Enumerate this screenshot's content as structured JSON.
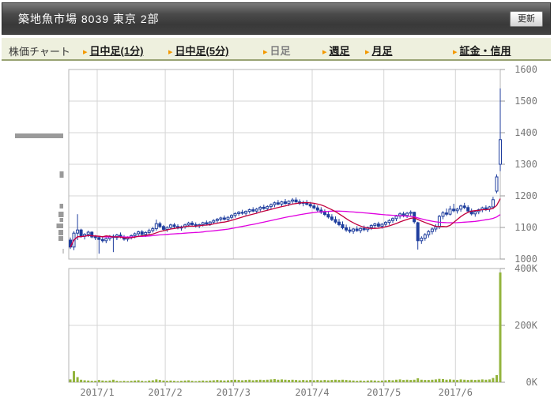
{
  "header": {
    "title": "築地魚市場  8039  東京 2部",
    "refresh_label": "更新"
  },
  "toolbar": {
    "label": "株価チャート",
    "tabs": [
      {
        "label": "日中足(1分)",
        "active": false
      },
      {
        "label": "日中足(5分)",
        "active": false
      },
      {
        "label": "日足",
        "active": true
      },
      {
        "label": "週足",
        "active": false
      },
      {
        "label": "月足",
        "active": false
      },
      {
        "label": "証金・信用",
        "active": false
      }
    ]
  },
  "chart_data": {
    "type": "candlestick+volume",
    "price_axis": {
      "min": 1000,
      "max": 1600,
      "ticks": [
        1000,
        1100,
        1200,
        1300,
        1400,
        1500,
        1600
      ]
    },
    "volume_axis": {
      "min": 0,
      "max": 400000,
      "tick_labels": [
        "0K",
        "200K",
        "400K"
      ]
    },
    "x_labels": [
      "2017/1",
      "2017/2",
      "2017/3",
      "2017/4",
      "2017/5",
      "2017/6"
    ],
    "month_ticks": [
      {
        "label": "2017/1",
        "index": 8
      },
      {
        "label": "2017/2",
        "index": 27
      },
      {
        "label": "2017/3",
        "index": 46
      },
      {
        "label": "2017/4",
        "index": 68
      },
      {
        "label": "2017/5",
        "index": 88
      },
      {
        "label": "2017/6",
        "index": 108
      }
    ],
    "ma_short_window": 10,
    "ma_long_window": 38,
    "colors": {
      "up_candle_fill": "#ffffff",
      "down_candle_fill": "#1f3e9e",
      "candle_outline": "#1f3e9e",
      "ma_short": "#c2003e",
      "ma_long": "#e000e0",
      "volume_bar": "#93b43d",
      "grid": "#d6d6d6",
      "border": "#b4b4b4",
      "axis_text": "#777777",
      "tick": "#999999"
    },
    "candles_format": [
      "open",
      "high",
      "low",
      "close",
      "volume_thousands"
    ],
    "candles": [
      [
        1060,
        1068,
        1032,
        1038,
        10
      ],
      [
        1038,
        1088,
        1028,
        1082,
        39
      ],
      [
        1082,
        1142,
        1060,
        1092,
        18
      ],
      [
        1092,
        1096,
        1068,
        1072,
        9
      ],
      [
        1072,
        1082,
        1062,
        1078,
        7
      ],
      [
        1078,
        1090,
        1070,
        1085,
        6
      ],
      [
        1085,
        1088,
        1066,
        1070,
        5
      ],
      [
        1070,
        1076,
        1060,
        1068,
        5
      ],
      [
        1068,
        1074,
        1017,
        1062,
        8
      ],
      [
        1062,
        1070,
        1052,
        1058,
        6
      ],
      [
        1058,
        1068,
        1050,
        1065,
        5
      ],
      [
        1065,
        1076,
        1058,
        1072,
        6
      ],
      [
        1072,
        1078,
        1022,
        1068,
        9
      ],
      [
        1068,
        1080,
        1060,
        1076,
        5
      ],
      [
        1076,
        1084,
        1066,
        1070,
        4
      ],
      [
        1070,
        1076,
        1058,
        1063,
        5
      ],
      [
        1063,
        1072,
        1056,
        1068,
        4
      ],
      [
        1068,
        1078,
        1062,
        1074,
        5
      ],
      [
        1074,
        1084,
        1066,
        1080,
        6
      ],
      [
        1080,
        1090,
        1072,
        1086,
        7
      ],
      [
        1086,
        1092,
        1074,
        1078,
        5
      ],
      [
        1078,
        1088,
        1070,
        1084,
        4
      ],
      [
        1084,
        1096,
        1078,
        1090,
        6
      ],
      [
        1090,
        1102,
        1084,
        1096,
        7
      ],
      [
        1096,
        1125,
        1090,
        1112,
        10
      ],
      [
        1112,
        1118,
        1098,
        1103,
        8
      ],
      [
        1103,
        1108,
        1088,
        1094,
        6
      ],
      [
        1094,
        1104,
        1086,
        1100,
        5
      ],
      [
        1100,
        1112,
        1094,
        1108,
        6
      ],
      [
        1108,
        1114,
        1098,
        1103,
        5
      ],
      [
        1103,
        1110,
        1094,
        1098,
        4
      ],
      [
        1098,
        1106,
        1090,
        1102,
        5
      ],
      [
        1102,
        1112,
        1096,
        1108,
        6
      ],
      [
        1108,
        1118,
        1102,
        1114,
        7
      ],
      [
        1114,
        1120,
        1104,
        1109,
        5
      ],
      [
        1109,
        1116,
        1100,
        1105,
        4
      ],
      [
        1105,
        1112,
        1098,
        1109,
        5
      ],
      [
        1109,
        1118,
        1103,
        1115,
        6
      ],
      [
        1115,
        1122,
        1106,
        1111,
        5
      ],
      [
        1111,
        1120,
        1105,
        1117,
        6
      ],
      [
        1117,
        1126,
        1110,
        1122,
        7
      ],
      [
        1122,
        1130,
        1115,
        1126,
        8
      ],
      [
        1126,
        1134,
        1119,
        1130,
        7
      ],
      [
        1130,
        1138,
        1122,
        1126,
        6
      ],
      [
        1126,
        1136,
        1120,
        1132,
        7
      ],
      [
        1132,
        1142,
        1126,
        1138,
        8
      ],
      [
        1138,
        1148,
        1131,
        1144,
        9
      ],
      [
        1144,
        1152,
        1137,
        1148,
        8
      ],
      [
        1148,
        1156,
        1140,
        1145,
        7
      ],
      [
        1145,
        1154,
        1138,
        1151,
        8
      ],
      [
        1151,
        1160,
        1144,
        1156,
        9
      ],
      [
        1156,
        1164,
        1148,
        1152,
        7
      ],
      [
        1152,
        1162,
        1146,
        1158,
        8
      ],
      [
        1158,
        1168,
        1151,
        1164,
        9
      ],
      [
        1164,
        1172,
        1156,
        1160,
        8
      ],
      [
        1160,
        1170,
        1153,
        1166,
        9
      ],
      [
        1166,
        1176,
        1159,
        1172,
        10
      ],
      [
        1172,
        1182,
        1164,
        1178,
        11
      ],
      [
        1178,
        1187,
        1170,
        1174,
        9
      ],
      [
        1174,
        1184,
        1167,
        1181,
        10
      ],
      [
        1181,
        1190,
        1172,
        1176,
        9
      ],
      [
        1176,
        1186,
        1168,
        1183,
        8
      ],
      [
        1183,
        1193,
        1175,
        1187,
        9
      ],
      [
        1187,
        1195,
        1178,
        1181,
        8
      ],
      [
        1181,
        1189,
        1171,
        1176,
        7
      ],
      [
        1176,
        1185,
        1167,
        1179,
        8
      ],
      [
        1179,
        1187,
        1170,
        1173,
        7
      ],
      [
        1173,
        1181,
        1162,
        1168,
        8
      ],
      [
        1168,
        1176,
        1157,
        1162,
        7
      ],
      [
        1162,
        1170,
        1150,
        1155,
        8
      ],
      [
        1155,
        1164,
        1143,
        1148,
        7
      ],
      [
        1148,
        1157,
        1136,
        1141,
        8
      ],
      [
        1141,
        1150,
        1128,
        1133,
        7
      ],
      [
        1133,
        1142,
        1120,
        1125,
        8
      ],
      [
        1125,
        1135,
        1112,
        1117,
        9
      ],
      [
        1117,
        1127,
        1104,
        1109,
        8
      ],
      [
        1109,
        1119,
        1094,
        1099,
        9
      ],
      [
        1099,
        1109,
        1086,
        1092,
        8
      ],
      [
        1092,
        1102,
        1082,
        1088,
        7
      ],
      [
        1088,
        1098,
        1080,
        1095,
        6
      ],
      [
        1095,
        1104,
        1086,
        1090,
        5
      ],
      [
        1090,
        1100,
        1082,
        1097,
        6
      ],
      [
        1097,
        1106,
        1088,
        1093,
        5
      ],
      [
        1093,
        1103,
        1085,
        1100,
        6
      ],
      [
        1100,
        1110,
        1092,
        1106,
        7
      ],
      [
        1106,
        1115,
        1098,
        1111,
        6
      ],
      [
        1111,
        1118,
        1100,
        1104,
        5
      ],
      [
        1104,
        1114,
        1096,
        1110,
        6
      ],
      [
        1110,
        1120,
        1102,
        1116,
        7
      ],
      [
        1116,
        1126,
        1108,
        1122,
        8
      ],
      [
        1122,
        1132,
        1114,
        1128,
        7
      ],
      [
        1128,
        1140,
        1120,
        1136,
        9
      ],
      [
        1136,
        1148,
        1128,
        1143,
        10
      ],
      [
        1143,
        1150,
        1132,
        1138,
        8
      ],
      [
        1138,
        1149,
        1130,
        1145,
        9
      ],
      [
        1145,
        1154,
        1136,
        1148,
        8
      ],
      [
        1148,
        1150,
        1112,
        1118,
        9
      ],
      [
        1115,
        1118,
        1030,
        1058,
        14
      ],
      [
        1058,
        1072,
        1048,
        1066,
        9
      ],
      [
        1066,
        1082,
        1058,
        1077,
        8
      ],
      [
        1077,
        1092,
        1068,
        1087,
        8
      ],
      [
        1087,
        1100,
        1078,
        1095,
        9
      ],
      [
        1095,
        1110,
        1086,
        1102,
        10
      ],
      [
        1102,
        1140,
        1095,
        1135,
        12
      ],
      [
        1135,
        1152,
        1126,
        1146,
        11
      ],
      [
        1146,
        1160,
        1136,
        1142,
        9
      ],
      [
        1142,
        1168,
        1138,
        1158,
        10
      ],
      [
        1158,
        1175,
        1148,
        1153,
        9
      ],
      [
        1153,
        1162,
        1144,
        1158,
        8
      ],
      [
        1158,
        1172,
        1150,
        1168,
        10
      ],
      [
        1168,
        1178,
        1158,
        1163,
        9
      ],
      [
        1163,
        1170,
        1148,
        1152,
        8
      ],
      [
        1152,
        1160,
        1138,
        1143,
        9
      ],
      [
        1143,
        1154,
        1134,
        1150,
        8
      ],
      [
        1150,
        1160,
        1142,
        1156,
        9
      ],
      [
        1156,
        1166,
        1148,
        1162,
        10
      ],
      [
        1162,
        1170,
        1152,
        1158,
        9
      ],
      [
        1158,
        1168,
        1150,
        1165,
        10
      ],
      [
        1165,
        1197,
        1158,
        1188,
        15
      ],
      [
        1215,
        1268,
        1208,
        1260,
        25
      ],
      [
        1300,
        1540,
        1278,
        1378,
        386
      ]
    ]
  },
  "left_artifacts": {
    "color": "#9a9a9a",
    "rects": [
      [
        19,
        169,
        61,
        6
      ],
      [
        75.5,
        217,
        5,
        8
      ],
      [
        75.5,
        258,
        4.5,
        6
      ],
      [
        74,
        268,
        6.5,
        7
      ],
      [
        75.5,
        276,
        4.5,
        5
      ],
      [
        71.5,
        283,
        8.5,
        6
      ],
      [
        74,
        291,
        6,
        7
      ],
      [
        74,
        299,
        6,
        6
      ],
      [
        79.5,
        315,
        1,
        6
      ]
    ]
  }
}
